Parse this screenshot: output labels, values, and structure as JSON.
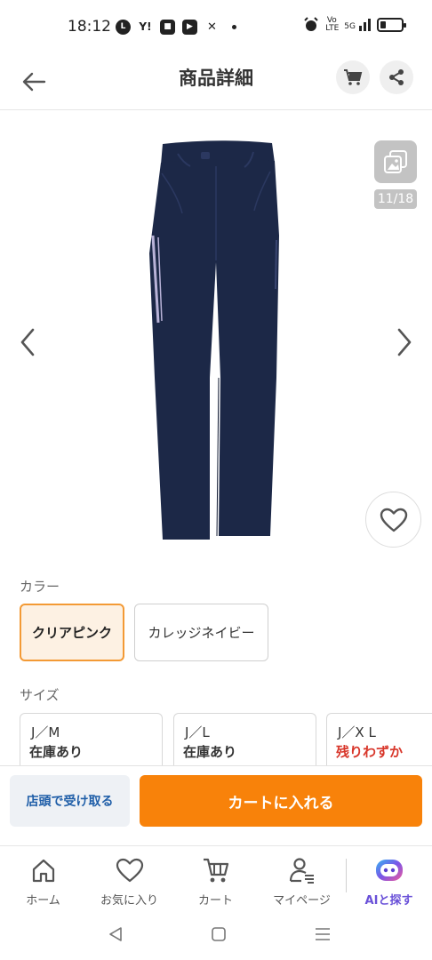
{
  "status": {
    "time": "18:12",
    "left_icons": [
      "line-icon",
      "yahoo-icon",
      "app-icon",
      "youtube-icon",
      "capcut-icon"
    ],
    "right": {
      "volte": "Vo LTE",
      "network": "5G"
    }
  },
  "header": {
    "title": "商品詳細"
  },
  "gallery": {
    "counter": "11/18",
    "product_color": "#1c2847",
    "stripe_color": "#b9b3d8"
  },
  "color_section": {
    "label": "カラー",
    "options": [
      "クリアピンク",
      "カレッジネイビー"
    ],
    "selected_index": 0
  },
  "size_section": {
    "label": "サイズ",
    "options": [
      {
        "name": "J／M",
        "stock": "在庫あり"
      },
      {
        "name": "J／L",
        "stock": "在庫あり"
      },
      {
        "name": "J／X L",
        "stock": "残りわずか"
      }
    ]
  },
  "actions": {
    "store_pickup": "店頭で受け取る",
    "add_to_cart": "カートに入れる"
  },
  "tabs": [
    {
      "label": "ホーム",
      "icon": "home-icon"
    },
    {
      "label": "お気に入り",
      "icon": "heart-icon"
    },
    {
      "label": "カート",
      "icon": "cart-icon"
    },
    {
      "label": "マイページ",
      "icon": "user-icon"
    },
    {
      "label": "AIと探す",
      "icon": "ai-bot-icon"
    }
  ],
  "colors": {
    "accent_orange": "#f8820a",
    "selected_border": "#f39a35",
    "low_stock_red": "#d8362a",
    "store_button_text": "#1f5ea8",
    "ai_purple": "#6950d8"
  }
}
